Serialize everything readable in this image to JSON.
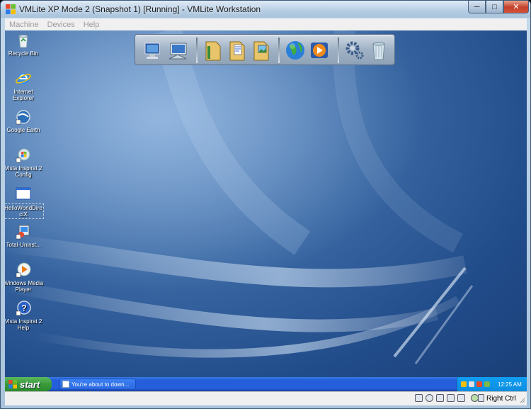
{
  "window": {
    "title": "VMLite XP Mode 2 (Snapshot 1) [Running] - VMLite Workstation",
    "controls": {
      "minimize": "─",
      "maximize": "□",
      "close": "✕"
    }
  },
  "menubar": {
    "items": [
      "Machine",
      "Devices",
      "Help"
    ]
  },
  "desktop_icons": [
    {
      "label": "Recycle Bin",
      "icon": "recycle-bin-icon"
    },
    {
      "label": "Internet Explorer",
      "icon": "internet-explorer-icon"
    },
    {
      "label": "Google Earth",
      "icon": "google-earth-icon"
    },
    {
      "label": "Vista Inspirat 2 Config",
      "icon": "vista-inspirat-config-icon"
    },
    {
      "label": "HelloWorldDire ctX",
      "icon": "window-icon"
    },
    {
      "label": "Total-Uninst...",
      "icon": "total-uninstall-icon"
    },
    {
      "label": "Windows Media Player",
      "icon": "windows-media-player-icon"
    },
    {
      "label": "Vista Inspirat 2 Help",
      "icon": "help-icon"
    }
  ],
  "dock": {
    "items": [
      "my-computer-icon",
      "network-icon",
      "folder-icon",
      "documents-icon",
      "pictures-icon",
      "globe-icon",
      "media-player-icon",
      "settings-gear-icon",
      "recycle-bin-icon"
    ]
  },
  "taskbar": {
    "start_label": "start",
    "task_label": "You're about to down...",
    "clock": "12:25 AM"
  },
  "statusbar": {
    "host_key": "Right Ctrl"
  },
  "colors": {
    "desktop": "#2a5592",
    "taskbar": "#245edb",
    "start": "#3a9a3a",
    "tray": "#0f9ef4"
  }
}
